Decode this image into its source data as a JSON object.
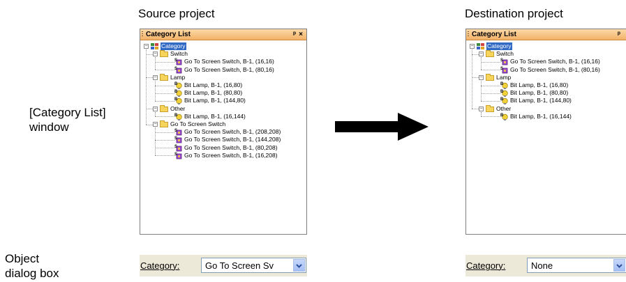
{
  "captions": {
    "source": "Source project",
    "destination": "Destination project",
    "category_list_window": [
      "[Category List]",
      "window"
    ],
    "object_dialog_box": [
      "Object",
      "dialog box"
    ]
  },
  "colors": {
    "title_bar": "#f3b267",
    "selection": "#316ac5",
    "folder": "#f7d45c",
    "dialog_bar": "#ece9d8",
    "arrow": "#000000"
  },
  "source_panel": {
    "title": "Category List",
    "pin_icon": "pin-icon",
    "close_icon": "close-icon",
    "pin_glyph": "ᵖ",
    "close_glyph": "×",
    "tree": {
      "root": "Category",
      "groups": [
        {
          "name": "Switch",
          "items": [
            "Go To Screen Switch, B-1, (16,16)",
            "Go To Screen Switch, B-1, (80,16)"
          ]
        },
        {
          "name": "Lamp",
          "items": [
            "Bit Lamp, B-1, (16,80)",
            "Bit Lamp, B-1, (80,80)",
            "Bit Lamp, B-1, (144,80)"
          ]
        },
        {
          "name": "Other",
          "items": [
            "Bit Lamp, B-1, (16,144)"
          ]
        },
        {
          "name": "Go To Screen Switch",
          "items": [
            "Go To Screen Switch, B-1, (208,208)",
            "Go To Screen Switch, B-1, (144,208)",
            "Go To Screen Switch, B-1, (80,208)",
            "Go To Screen Switch, B-1, (16,208)"
          ]
        }
      ]
    }
  },
  "destination_panel": {
    "title": "Category List",
    "pin_glyph": "ᵖ",
    "tree": {
      "root": "Category",
      "groups": [
        {
          "name": "Switch",
          "items": [
            "Go To Screen Switch, B-1, (16,16)",
            "Go To Screen Switch, B-1, (80,16)"
          ]
        },
        {
          "name": "Lamp",
          "items": [
            "Bit Lamp, B-1, (16,80)",
            "Bit Lamp, B-1, (80,80)",
            "Bit Lamp, B-1, (144,80)"
          ]
        },
        {
          "name": "Other",
          "items": [
            "Bit Lamp, B-1, (16,144)"
          ]
        }
      ]
    }
  },
  "source_dialog": {
    "label": "Category:",
    "value": "Go To Screen Sv"
  },
  "destination_dialog": {
    "label": "Category:",
    "value": "None"
  }
}
